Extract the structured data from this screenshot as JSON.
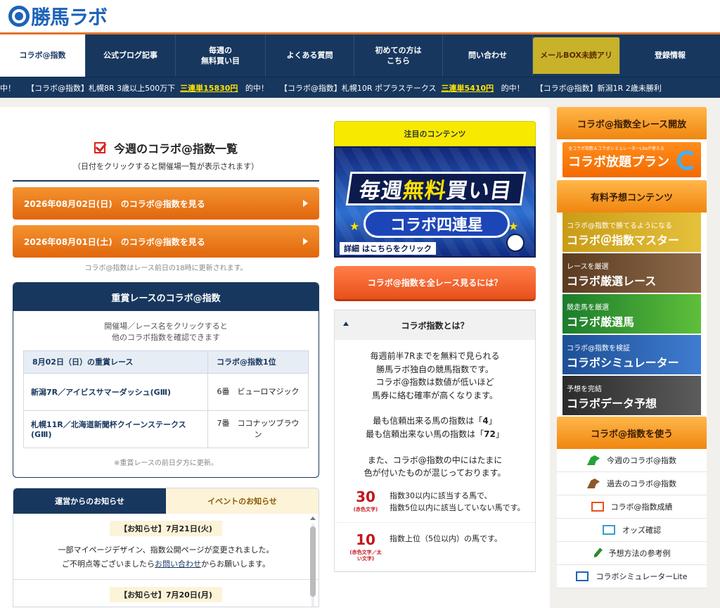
{
  "logo": {
    "text": "勝馬ラボ"
  },
  "nav": {
    "items": [
      {
        "label": "コラボ@指数"
      },
      {
        "label": "公式ブログ記事"
      },
      {
        "label": "毎週の\n無料買い目"
      },
      {
        "label": "よくある質問"
      },
      {
        "label": "初めての方は\nこちら"
      },
      {
        "label": "問い合わせ"
      },
      {
        "label": "メールBOX未読アリ"
      },
      {
        "label": "登録情報"
      }
    ]
  },
  "ticker": {
    "segments": [
      {
        "pre": "中！",
        "hit": "",
        "post": ""
      },
      {
        "pre": "【コラボ@指数】札幌8R 3歳以上500万下",
        "hit": "三連単15830円",
        "post": "的中！"
      },
      {
        "pre": "【コラボ@指数】札幌10R ポプラステークス",
        "hit": "三連単5410円",
        "post": "的中！"
      },
      {
        "pre": "【コラボ@指数】新潟1R 2歳未勝利",
        "hit": "",
        "post": ""
      }
    ]
  },
  "index_list": {
    "title": "今週のコラボ@指数一覧",
    "subtitle": "（日付をクリックすると開催場一覧が表示されます）",
    "buttons": [
      {
        "label": "2026年08月02日(日)　のコラボ@指数を見る"
      },
      {
        "label": "2026年08月01日(土)　のコラボ@指数を見る"
      }
    ],
    "update_note": "コラボ@指数はレース前日の18時に更新されます。"
  },
  "grade": {
    "header": "重賞レースのコラボ@指数",
    "desc_line1": "開催場／レース名をクリックすると",
    "desc_line2": "他のコラボ指数を確認できます",
    "col1": "8月02日（日）の重賞レース",
    "col2": "コラボ@指数1位",
    "rows": [
      {
        "race": "新潟7R／アイビスサマーダッシュ(GⅢ)",
        "horse": "6番　ビューロマジック"
      },
      {
        "race": "札幌11R／北海道新聞杯クイーンステークス(GⅢ)",
        "horse": "7番　ココナッツブラウン"
      }
    ],
    "note": "※重賞レースの前日夕方に更新。"
  },
  "news": {
    "tab1": "運営からのお知らせ",
    "tab2": "イベントのお知らせ",
    "item1_head": "【お知らせ】7月21日(火)",
    "item1_l1": "一部マイページデザイン、指数公開ページが変更されました。",
    "item1_l2a": "ご不明点等ございましたら",
    "item1_link": "お問い合わせ",
    "item1_l2b": "からお願いします。",
    "item2_head": "【お知らせ】7月20日(月)"
  },
  "featured": {
    "header": "注目のコンテンツ",
    "banner_line1_a": "毎週",
    "banner_line1_b": "無料",
    "banner_line1_c": "買い目",
    "banner_line2": "コラボ四連星",
    "banner_foot": "詳細 はこちらをクリック",
    "all_races_btn": "コラボ@指数を全レース見るには？"
  },
  "about": {
    "header": "コラボ指数とは？",
    "p1": [
      "毎週前半7Rまでを無料で見られる",
      "勝馬ラボ独自の競馬指数です。",
      "コラボ@指数は数値が低いほど",
      "馬券に絡む確率が高くなります。"
    ],
    "best_a": "最も信頼出来る馬の指数は「",
    "best_v": "4",
    "best_b": "」",
    "worst_a": "最も信頼出来ない馬の指数は「",
    "worst_v": "72",
    "worst_b": "」",
    "p3": [
      "また、コラボ@指数の中にはたまに",
      "色が付いたものが混じっております。"
    ],
    "legend": [
      {
        "num": "30",
        "small": "(赤色文字)",
        "l1": "指数30以内に該当する馬で、",
        "l2": "指数5位以内に該当していない馬です。"
      },
      {
        "num": "10",
        "small": "(赤色文字／太い文字)",
        "l1": "指数上位（5位以内）の馬です。",
        "l2": ""
      }
    ]
  },
  "sidebar": {
    "h1": "コラボ@指数全レース開放",
    "plan_small": "全コラボ指数＆コラボシミュレーターLiteが使える",
    "plan_title": "コラボ放題プラン",
    "h2": "有料予想コンテンツ",
    "paid": [
      {
        "t1": "コラボ@指数で勝てるようになる",
        "t2": "コラボ＠指数マスター"
      },
      {
        "t1": "レースを厳選",
        "t2": "コラボ厳選レース"
      },
      {
        "t1": "競走馬を厳選",
        "t2": "コラボ厳選馬"
      },
      {
        "t1": "コラボ@指数を検証",
        "t2": "コラボシミュレーター"
      },
      {
        "t1": "予想を完結",
        "t2": "コラボデータ予想"
      }
    ],
    "h3": "コラボ@指数を使う",
    "links": [
      {
        "label": "今週のコラボ@指数",
        "icon": "green-horse-icon"
      },
      {
        "label": "過去のコラボ@指数",
        "icon": "brown-horse-icon"
      },
      {
        "label": "コラボ@指数成績",
        "icon": "chart-icon"
      },
      {
        "label": "オッズ確認",
        "icon": "table-icon"
      },
      {
        "label": "予想方法の参考例",
        "icon": "pencil-icon"
      },
      {
        "label": "コラボシミュレーターLite",
        "icon": "laptop-icon"
      }
    ]
  }
}
